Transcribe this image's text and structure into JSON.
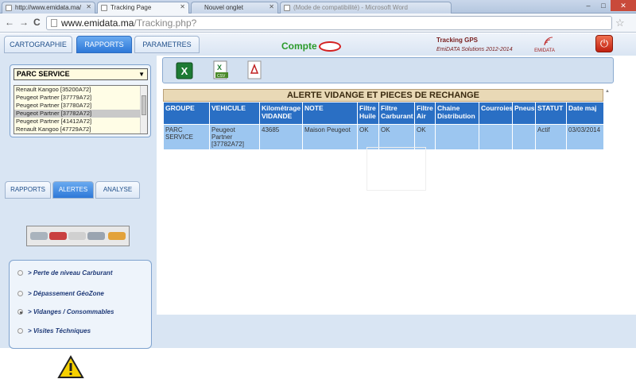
{
  "browser": {
    "tabs": [
      {
        "title": "http://www.emidata.ma/"
      },
      {
        "title": "Tracking Page"
      },
      {
        "title": "Nouvel onglet"
      },
      {
        "title": "(Mode de compatibilité) - Microsoft Word"
      }
    ],
    "url_host": "www.emidata.ma",
    "url_path": "/Tracking.php?",
    "window_controls": {
      "minimize": "–",
      "maximize": "□",
      "close": "✕"
    },
    "nav": {
      "back": "←",
      "forward": "→",
      "reload": "C"
    }
  },
  "header": {
    "tabs": [
      "CARTOGRAPHIE",
      "RAPPORTS",
      "PARAMETRES"
    ],
    "active_tab": "RAPPORTS",
    "compte_label": "Compte :",
    "brand_title": "Tracking GPS",
    "brand_sub": "EmiDATA Solutions 2012-2014",
    "logo_text": "EMIDATA"
  },
  "left": {
    "parc_select": "PARC SERVICE",
    "vehicles": [
      "Renault Kangoo [35200A72]",
      "Peugeot Partner [37779A72]",
      "Peugeot Partner [37780A72]",
      "Peugeot Partner [37782A72]",
      "Peugeot Partner [41412A72]",
      "Renault Kangoo [47729A72]"
    ],
    "selected_vehicle_index": 3,
    "subtabs": [
      "RAPPORTS",
      "ALERTES",
      "ANALYSE"
    ],
    "active_subtab": "ALERTES",
    "alerts": [
      {
        "label": "> Perte de niveau Carburant",
        "selected": false
      },
      {
        "label": "> Dépassement GéoZone",
        "selected": false
      },
      {
        "label": "> Vidanges / Consommables",
        "selected": true
      },
      {
        "label": "> Visites Téchniques",
        "selected": false
      }
    ]
  },
  "toolbar": {
    "icons": [
      "excel-icon",
      "csv-icon",
      "pdf-icon"
    ],
    "csv_label": "CSV"
  },
  "grid": {
    "title": "ALERTE VIDANGE ET PIECES DE RECHANGE",
    "columns": [
      "GROUPE",
      "VEHICULE",
      "Kilométrage VIDANDE",
      "NOTE",
      "Filtre Huile",
      "Filtre Carburant",
      "Filtre Air",
      "Chaine Distribution",
      "Courroies",
      "Pneus",
      "STATUT",
      "Date maj"
    ],
    "rows": [
      [
        "PARC SERVICE",
        "Peugeot Partner [37782A72]",
        "43685",
        "Maison Peugeot",
        "OK",
        "OK",
        "OK",
        "",
        "",
        "",
        "Actif",
        "03/03/2014"
      ]
    ]
  },
  "colors": {
    "accent": "#2d78d8",
    "page_bg": "#d9e5f3",
    "header_row": "#2a6fc4",
    "data_row": "#9cc6f0",
    "compte": "#2a9a2a"
  }
}
